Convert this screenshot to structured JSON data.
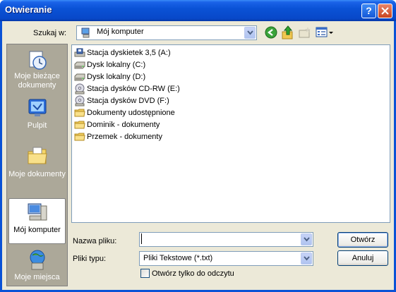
{
  "window": {
    "title": "Otwieranie"
  },
  "lookin": {
    "label": "Szukaj w:",
    "value": "Mój komputer"
  },
  "places": [
    {
      "line1": "Moje bieżące",
      "line2": "dokumenty"
    },
    {
      "line1": "Pulpit",
      "line2": ""
    },
    {
      "line1": "Moje dokumenty",
      "line2": ""
    },
    {
      "line1": "Mój komputer",
      "line2": ""
    },
    {
      "line1": "Moje miejsca",
      "line2": ""
    }
  ],
  "files": [
    {
      "name": "Stacja dyskietek 3,5 (A:)",
      "icon": "floppy-drive-icon"
    },
    {
      "name": "Dysk lokalny (C:)",
      "icon": "hard-drive-icon"
    },
    {
      "name": "Dysk lokalny (D:)",
      "icon": "hard-drive-icon"
    },
    {
      "name": "Stacja dysków CD-RW (E:)",
      "icon": "cd-drive-icon"
    },
    {
      "name": "Stacja dysków DVD (F:)",
      "icon": "cd-drive-icon"
    },
    {
      "name": "Dokumenty udostępnione",
      "icon": "folder-icon"
    },
    {
      "name": "Dominik - dokumenty",
      "icon": "folder-icon"
    },
    {
      "name": "Przemek - dokumenty",
      "icon": "folder-icon"
    }
  ],
  "filename": {
    "label": "Nazwa pliku:",
    "value": ""
  },
  "filetype": {
    "label": "Pliki typu:",
    "value": "Pliki Tekstowe (*.txt)"
  },
  "readonly": {
    "label": "Otwórz tylko do odczytu"
  },
  "buttons": {
    "open": "Otwórz",
    "cancel": "Anuluj"
  },
  "titlebar": {
    "help": "?"
  }
}
